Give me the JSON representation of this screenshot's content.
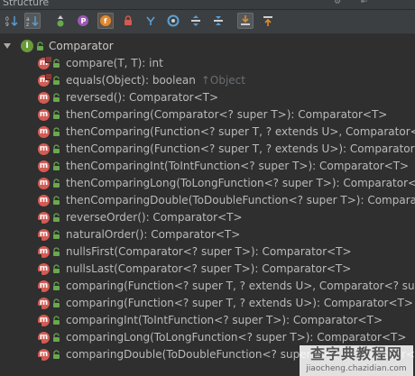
{
  "window": {
    "title": "Structure"
  },
  "toolbar": {
    "buttons": [
      {
        "name": "sort-visibility-button",
        "icon": "sort-visibility-icon"
      },
      {
        "name": "sort-alpha-button",
        "icon": "sort-alpha-icon"
      },
      {
        "name": "show-inherited-button",
        "icon": "inherited-icon"
      },
      {
        "name": "show-properties-button",
        "icon": "property-icon"
      },
      {
        "name": "show-fields-button",
        "icon": "field-icon"
      },
      {
        "name": "show-non-public-button",
        "icon": "lock-icon"
      },
      {
        "name": "show-lambdas-button",
        "icon": "lambda-icon"
      },
      {
        "name": "show-anonymous-button",
        "icon": "anonymous-icon"
      },
      {
        "name": "expand-all-button",
        "icon": "expand-all-icon"
      },
      {
        "name": "collapse-all-button",
        "icon": "collapse-all-icon"
      },
      {
        "name": "autoscroll-to-source-button",
        "icon": "autoscroll-to-source-icon"
      },
      {
        "name": "autoscroll-from-source-button",
        "icon": "autoscroll-from-source-icon"
      }
    ]
  },
  "tree": {
    "root": {
      "label": "Comparator",
      "icon": "interface-icon"
    },
    "members": [
      {
        "label": "compare(T, T): int",
        "kind": "abstract",
        "inherited": ""
      },
      {
        "label": "equals(Object): boolean",
        "kind": "abstract",
        "inherited": "↑Object"
      },
      {
        "label": "reversed(): Comparator<T>",
        "kind": "method",
        "inherited": ""
      },
      {
        "label": "thenComparing(Comparator<? super T>): Comparator<T>",
        "kind": "method",
        "inherited": ""
      },
      {
        "label": "thenComparing(Function<? super T, ? extends U>, Comparator<? s",
        "kind": "method",
        "inherited": ""
      },
      {
        "label": "thenComparing(Function<? super T, ? extends U>): Comparator<T",
        "kind": "method",
        "inherited": ""
      },
      {
        "label": "thenComparingInt(ToIntFunction<? super T>): Comparator<T>",
        "kind": "method",
        "inherited": ""
      },
      {
        "label": "thenComparingLong(ToLongFunction<? super T>): Comparator<T>",
        "kind": "method",
        "inherited": ""
      },
      {
        "label": "thenComparingDouble(ToDoubleFunction<? super T>): Comparato",
        "kind": "method",
        "inherited": ""
      },
      {
        "label": "reverseOrder(): Comparator<T>",
        "kind": "static",
        "inherited": ""
      },
      {
        "label": "naturalOrder(): Comparator<T>",
        "kind": "static",
        "inherited": ""
      },
      {
        "label": "nullsFirst(Comparator<? super T>): Comparator<T>",
        "kind": "static",
        "inherited": ""
      },
      {
        "label": "nullsLast(Comparator<? super T>): Comparator<T>",
        "kind": "static",
        "inherited": ""
      },
      {
        "label": "comparing(Function<? super T, ? extends U>, Comparator<? supe",
        "kind": "static",
        "inherited": ""
      },
      {
        "label": "comparing(Function<? super T, ? extends U>): Comparator<T>",
        "kind": "static",
        "inherited": ""
      },
      {
        "label": "comparingInt(ToIntFunction<? super T>): Comparator<T>",
        "kind": "static",
        "inherited": ""
      },
      {
        "label": "comparingLong(ToLongFunction<? super T>): Comparator<T>",
        "kind": "static",
        "inherited": ""
      },
      {
        "label": "comparingDouble(ToDoubleFunction<? super T>): Comparator<T>",
        "kind": "static",
        "inherited": ""
      }
    ]
  },
  "watermark": {
    "title": "查字典教程网",
    "url": "jiaocheng.chazidian.com"
  },
  "colors": {
    "method_icon": "#d35b54",
    "access_green": "#6aa84f",
    "interface_icon": "#6a9b3a",
    "selected_button": "#e08a2f"
  }
}
